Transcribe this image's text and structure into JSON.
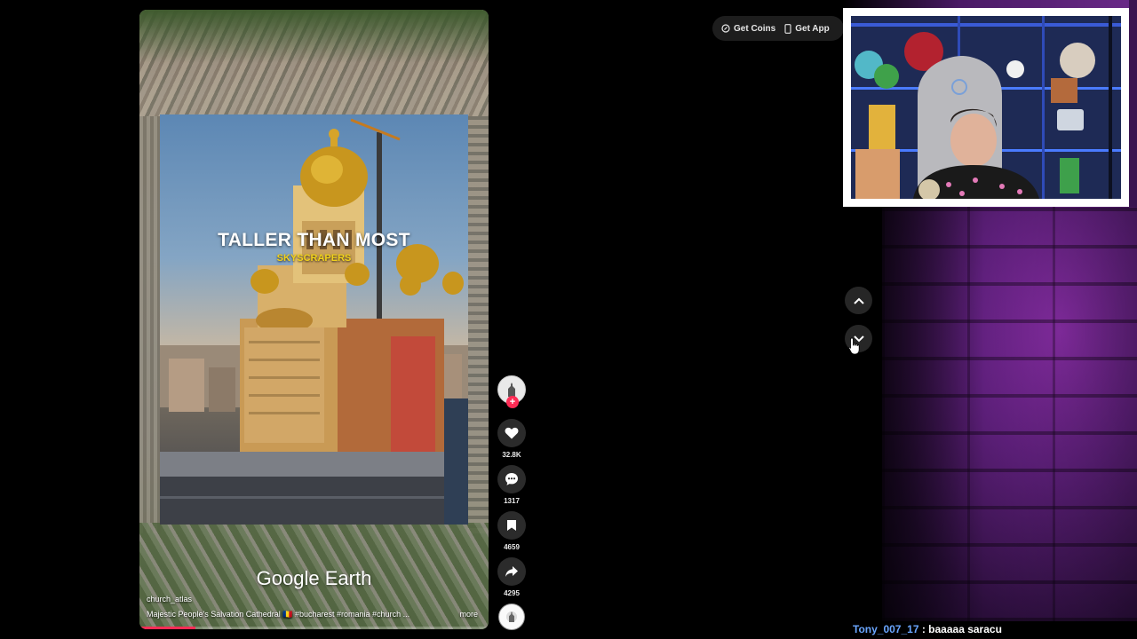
{
  "video": {
    "caption_main": "TALLER THAN MOST",
    "caption_sub": "SKYSCRAPERS",
    "overlay_logo": "Google Earth",
    "author": "church_atlas",
    "description": "Majestic People's Salvation Cathedral 🇷🇴 #bucharest #romania #church ...",
    "more_label": "more",
    "progress_fraction": 0.16
  },
  "actions": {
    "likes": "32.8K",
    "comments": "1317",
    "saves": "4659",
    "shares": "4295",
    "icons": [
      "heart-icon",
      "comment-icon",
      "bookmark-icon",
      "share-icon"
    ]
  },
  "topbar": {
    "get_coins": "Get Coins",
    "get_app": "Get App"
  },
  "chat": {
    "user": "Tony_007_17",
    "message": ": baaaaa saracu"
  },
  "colors": {
    "accent": "#fe2c55",
    "caption_sub": "#f2d21c",
    "chat_user": "#6aa6ff"
  }
}
